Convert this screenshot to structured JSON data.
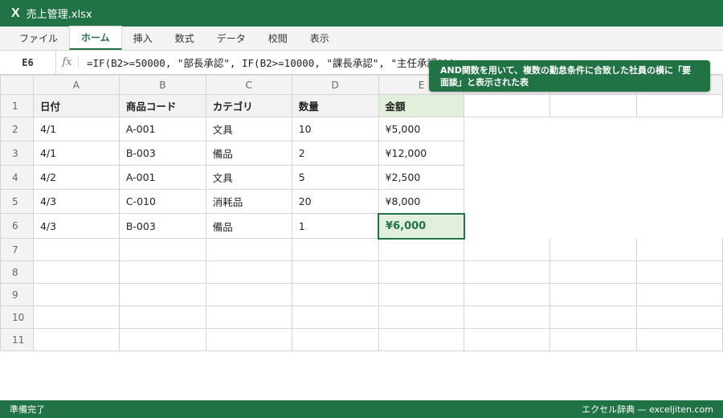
{
  "window": {
    "icon": "excel-x-icon",
    "title": "売上管理.xlsx"
  },
  "ribbon": {
    "tabs": [
      "ファイル",
      "ホーム",
      "挿入",
      "数式",
      "データ",
      "校閲",
      "表示"
    ],
    "active_tab": "ホーム"
  },
  "formula_bar": {
    "cell_ref": "E6",
    "fx_label": "fx",
    "formula": "=IF(B2>=50000, \"部長承認\", IF(B2>=10000, \"課長承認\", \"主任承認\"))"
  },
  "columns": [
    "A",
    "B",
    "C",
    "D",
    "E",
    "",
    "",
    ""
  ],
  "rows": [
    "1",
    "2",
    "3",
    "4",
    "5",
    "6",
    "7",
    "8",
    "9",
    "10",
    "11"
  ],
  "table": {
    "headers": [
      "日付",
      "商品コード",
      "カテゴリ",
      "数量",
      "金額"
    ],
    "data": [
      [
        "4/1",
        "A-001",
        "文具",
        "10",
        "¥5,000"
      ],
      [
        "4/1",
        "B-003",
        "備品",
        "2",
        "¥12,000"
      ],
      [
        "4/2",
        "A-001",
        "文具",
        "5",
        "¥2,500"
      ],
      [
        "4/3",
        "C-010",
        "消耗品",
        "20",
        "¥8,000"
      ],
      [
        "4/3",
        "B-003",
        "備品",
        "1",
        "¥6,000"
      ]
    ]
  },
  "callout": {
    "text": "AND関数を用いて、複数の勤怠条件に合致した社員の横に「要面談」と表示された表"
  },
  "status": {
    "left": "準備完了",
    "right": "エクセル辞典 — exceljiten.com"
  },
  "colors": {
    "accent": "#217346",
    "selected_fill": "#e2efda"
  }
}
